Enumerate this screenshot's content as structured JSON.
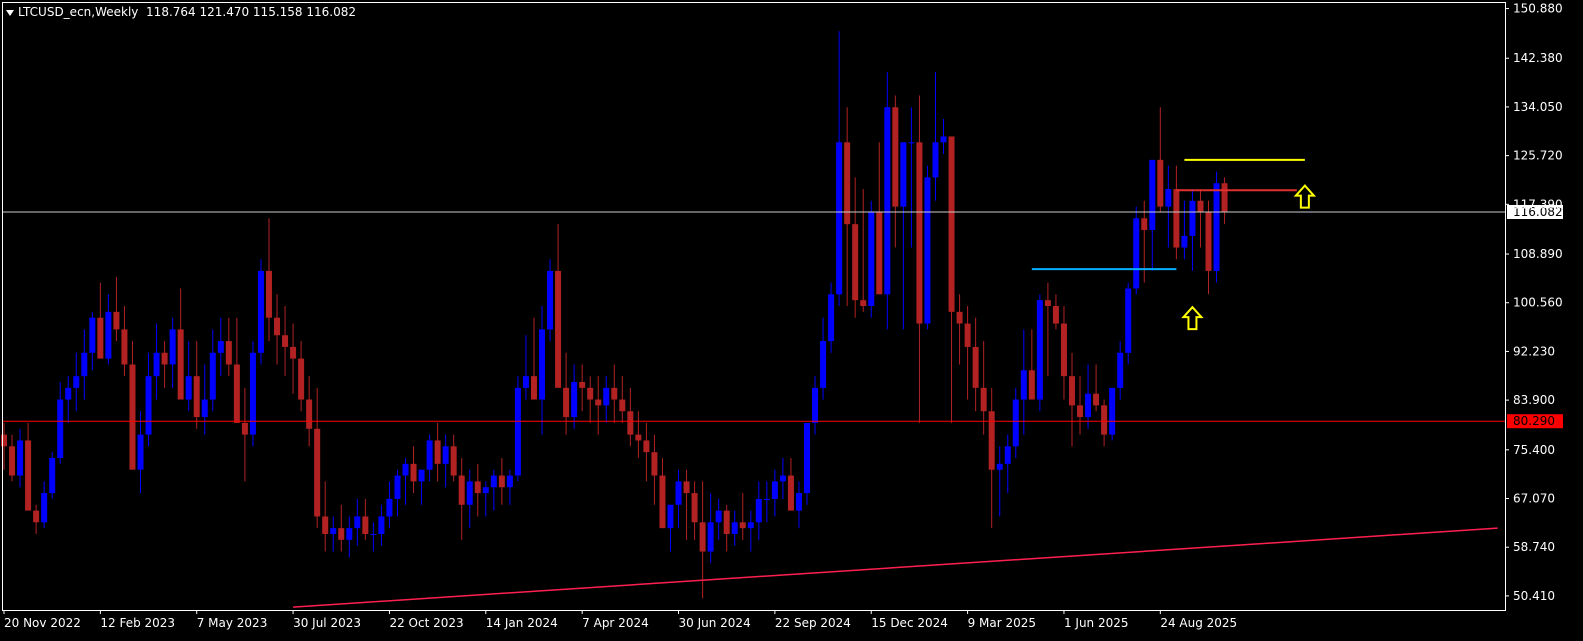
{
  "header": {
    "symbol": "LTCUSD_ecn,Weekly",
    "ohlc": "118.764 121.470 115.158 116.082"
  },
  "colors": {
    "background": "#000000",
    "bull": "#0000ff",
    "bear": "#b22222",
    "axis_text": "#ffffff",
    "grid": "#ffffff"
  },
  "chart_data": {
    "type": "candlestick",
    "timeframe": "Weekly",
    "ylim": [
      48.0,
      152.0
    ],
    "y_ticks": [
      "150.880",
      "142.380",
      "134.050",
      "125.720",
      "117.390",
      "108.890",
      "100.560",
      "92.230",
      "83.900",
      "75.400",
      "67.070",
      "58.740",
      "50.410"
    ],
    "x_ticks": [
      "20 Nov 2022",
      "12 Feb 2023",
      "7 May 2023",
      "30 Jul 2023",
      "22 Oct 2023",
      "14 Jan 2024",
      "7 Apr 2024",
      "30 Jun 2024",
      "22 Sep 2024",
      "15 Dec 2024",
      "9 Mar 2025",
      "1 Jun 2025",
      "24 Aug 2025"
    ],
    "last_price": {
      "value": 116.082,
      "label": "116.082"
    },
    "level_line": {
      "value": 80.29,
      "label": "80.290",
      "color": "#ff0000"
    },
    "candles": [
      [
        78,
        80,
        72,
        76
      ],
      [
        76,
        78,
        70,
        71
      ],
      [
        71,
        79,
        69,
        77
      ],
      [
        77,
        80,
        66,
        65
      ],
      [
        65,
        66,
        61,
        63
      ],
      [
        63,
        70,
        62,
        68
      ],
      [
        68,
        75,
        67,
        74
      ],
      [
        74,
        87,
        73,
        84
      ],
      [
        84,
        88,
        80,
        86
      ],
      [
        86,
        92,
        82,
        88
      ],
      [
        88,
        96,
        84,
        92
      ],
      [
        92,
        99,
        89,
        98
      ],
      [
        98,
        104,
        92,
        91
      ],
      [
        91,
        102,
        90,
        99
      ],
      [
        99,
        105,
        94,
        96
      ],
      [
        96,
        100,
        88,
        90
      ],
      [
        90,
        94,
        73,
        72
      ],
      [
        72,
        82,
        68,
        78
      ],
      [
        78,
        92,
        76,
        88
      ],
      [
        88,
        97,
        84,
        92
      ],
      [
        92,
        94,
        86,
        90
      ],
      [
        90,
        98,
        86,
        96
      ],
      [
        96,
        103,
        90,
        84
      ],
      [
        84,
        94,
        82,
        88
      ],
      [
        88,
        94,
        79,
        81
      ],
      [
        81,
        90,
        78,
        84
      ],
      [
        84,
        96,
        82,
        92
      ],
      [
        92,
        98,
        88,
        94
      ],
      [
        94,
        98,
        88,
        90
      ],
      [
        90,
        98,
        84,
        80
      ],
      [
        80,
        86,
        70,
        78
      ],
      [
        78,
        94,
        76,
        92
      ],
      [
        92,
        108,
        90,
        106
      ],
      [
        106,
        115,
        94,
        98
      ],
      [
        98,
        102,
        90,
        95
      ],
      [
        95,
        100,
        88,
        93
      ],
      [
        93,
        97,
        85,
        91
      ],
      [
        91,
        94,
        82,
        84
      ],
      [
        84,
        88,
        76,
        79
      ],
      [
        79,
        86,
        62,
        64
      ],
      [
        64,
        70,
        58,
        61
      ],
      [
        61,
        64,
        58,
        62
      ],
      [
        62,
        66,
        58,
        60
      ],
      [
        60,
        64,
        57,
        62
      ],
      [
        62,
        67,
        59,
        64
      ],
      [
        64,
        67,
        60,
        61
      ],
      [
        61,
        63,
        58,
        61
      ],
      [
        61,
        66,
        59,
        64
      ],
      [
        64,
        70,
        62,
        67
      ],
      [
        67,
        72,
        64,
        71
      ],
      [
        71,
        74,
        66,
        73
      ],
      [
        73,
        76,
        68,
        70
      ],
      [
        70,
        72,
        66,
        72
      ],
      [
        72,
        78,
        70,
        77
      ],
      [
        77,
        80,
        70,
        73
      ],
      [
        73,
        78,
        69,
        76
      ],
      [
        76,
        78,
        70,
        71
      ],
      [
        71,
        74,
        60,
        66
      ],
      [
        66,
        72,
        62,
        70
      ],
      [
        70,
        73,
        64,
        68
      ],
      [
        68,
        70,
        64,
        69
      ],
      [
        69,
        72,
        65,
        71
      ],
      [
        71,
        74,
        66,
        69
      ],
      [
        69,
        72,
        66,
        71
      ],
      [
        71,
        88,
        70,
        86
      ],
      [
        86,
        95,
        84,
        88
      ],
      [
        88,
        98,
        84,
        84
      ],
      [
        84,
        100,
        78,
        96
      ],
      [
        96,
        108,
        94,
        106
      ],
      [
        106,
        114,
        90,
        86
      ],
      [
        86,
        92,
        78,
        81
      ],
      [
        81,
        90,
        79,
        87
      ],
      [
        87,
        90,
        82,
        86
      ],
      [
        86,
        88,
        80,
        84
      ],
      [
        84,
        88,
        78,
        83
      ],
      [
        83,
        88,
        80,
        86
      ],
      [
        86,
        90,
        80,
        84
      ],
      [
        84,
        88,
        80,
        82
      ],
      [
        82,
        86,
        76,
        78
      ],
      [
        78,
        82,
        74,
        77
      ],
      [
        77,
        80,
        70,
        75
      ],
      [
        75,
        78,
        66,
        71
      ],
      [
        71,
        74,
        66,
        62
      ],
      [
        62,
        66,
        58,
        66
      ],
      [
        66,
        72,
        62,
        70
      ],
      [
        70,
        72,
        60,
        68
      ],
      [
        68,
        70,
        60,
        63
      ],
      [
        63,
        70,
        50,
        58
      ],
      [
        58,
        68,
        56,
        63
      ],
      [
        63,
        67,
        60,
        65
      ],
      [
        65,
        66,
        58,
        61
      ],
      [
        61,
        65,
        59,
        63
      ],
      [
        63,
        68,
        60,
        62
      ],
      [
        62,
        65,
        58,
        63
      ],
      [
        63,
        70,
        60,
        67
      ],
      [
        67,
        70,
        63,
        67
      ],
      [
        67,
        72,
        64,
        70
      ],
      [
        70,
        74,
        67,
        71
      ],
      [
        71,
        74,
        67,
        65
      ],
      [
        65,
        70,
        62,
        68
      ],
      [
        68,
        74,
        66,
        80
      ],
      [
        80,
        88,
        78,
        86
      ],
      [
        86,
        98,
        84,
        94
      ],
      [
        94,
        104,
        92,
        102
      ],
      [
        102,
        147,
        100,
        128
      ],
      [
        128,
        134,
        100,
        114
      ],
      [
        114,
        122,
        98,
        101
      ],
      [
        101,
        120,
        99,
        100
      ],
      [
        100,
        118,
        98,
        116
      ],
      [
        116,
        128,
        112,
        102
      ],
      [
        102,
        140,
        96,
        134
      ],
      [
        134,
        136,
        110,
        117
      ],
      [
        117,
        122,
        96,
        128
      ],
      [
        128,
        134,
        110,
        128
      ],
      [
        128,
        136,
        80,
        97
      ],
      [
        97,
        124,
        96,
        122
      ],
      [
        122,
        140,
        118,
        128
      ],
      [
        128,
        132,
        126,
        129
      ],
      [
        129,
        126,
        80,
        99
      ],
      [
        99,
        102,
        90,
        97
      ],
      [
        97,
        100,
        84,
        93
      ],
      [
        93,
        98,
        82,
        86
      ],
      [
        86,
        94,
        78,
        82
      ],
      [
        82,
        86,
        62,
        72
      ],
      [
        72,
        76,
        64,
        73
      ],
      [
        73,
        78,
        68,
        76
      ],
      [
        76,
        86,
        74,
        84
      ],
      [
        84,
        96,
        78,
        89
      ],
      [
        89,
        96,
        84,
        84
      ],
      [
        84,
        102,
        82,
        101
      ],
      [
        101,
        104,
        88,
        100
      ],
      [
        100,
        102,
        96,
        97
      ],
      [
        97,
        100,
        84,
        88
      ],
      [
        88,
        92,
        76,
        83
      ],
      [
        83,
        88,
        78,
        81
      ],
      [
        81,
        90,
        79,
        85
      ],
      [
        85,
        90,
        82,
        83
      ],
      [
        83,
        84,
        76,
        78
      ],
      [
        78,
        86,
        77,
        86
      ],
      [
        86,
        94,
        84,
        92
      ],
      [
        92,
        104,
        90,
        103
      ],
      [
        103,
        117,
        102,
        115
      ],
      [
        115,
        118,
        104,
        113
      ],
      [
        113,
        117,
        106,
        125
      ],
      [
        125,
        134,
        116,
        117
      ],
      [
        117,
        124,
        110,
        120
      ],
      [
        120,
        124,
        108,
        110
      ],
      [
        110,
        118,
        108,
        112
      ],
      [
        112,
        120,
        106,
        118
      ],
      [
        118,
        120,
        110,
        116
      ],
      [
        116,
        118,
        102,
        106
      ],
      [
        106,
        123,
        104,
        121
      ],
      [
        121,
        122,
        114,
        116
      ]
    ],
    "annotations": [
      {
        "type": "hline",
        "from": 147,
        "to": 162,
        "value": 125.0,
        "color": "#ffff00"
      },
      {
        "type": "hline",
        "from": 146,
        "to": 161,
        "value": 119.8,
        "color": "#e03030"
      },
      {
        "type": "hline",
        "from": 128,
        "to": 146,
        "value": 106.3,
        "color": "#00b0ff"
      },
      {
        "type": "trendline",
        "from": [
          36,
          48.5
        ],
        "to": [
          186,
          62.0
        ],
        "color": "#ff2050"
      },
      {
        "type": "arrow-up",
        "at": 162,
        "value": 120.6,
        "color": "#ffff00"
      },
      {
        "type": "arrow-up",
        "at": 148,
        "value": 99.8,
        "color": "#ffff00"
      }
    ]
  }
}
